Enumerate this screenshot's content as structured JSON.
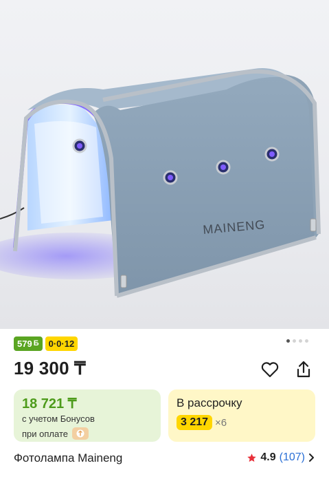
{
  "product": {
    "image_brand_text": "MAINENG",
    "title": "Фотолампа Maineng",
    "price": "19 300 ₸"
  },
  "badges": {
    "bonus_amount": "579",
    "bonus_symbol": "Б",
    "installment": "0·0·12"
  },
  "gallery": {
    "total_images": 4,
    "current_index": 1
  },
  "bonus_card": {
    "price": "18 721 ₸",
    "line1": "с учетом Бонусов",
    "line2": "при оплате"
  },
  "installment_card": {
    "title": "В рассрочку",
    "amount": "3 217",
    "multiplier": "×6"
  },
  "rating": {
    "value": "4.9",
    "count": "(107)"
  },
  "colors": {
    "accent_green": "#5aa522",
    "accent_yellow": "#ffd600",
    "link_blue": "#2a6fd6",
    "star_red": "#e8303a"
  }
}
